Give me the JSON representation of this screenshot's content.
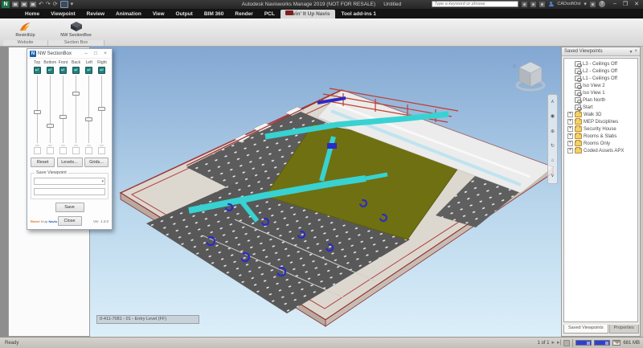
{
  "window": {
    "title": "Autodesk Navisworks Manage 2019 (NOT FOR RESALE)",
    "document": "Untitled",
    "search_placeholder": "Type a keyword or phrase",
    "signin": "CADsoftOst",
    "minimize": "–",
    "maximize": "❐",
    "close": "✕"
  },
  "ribbon": {
    "tabs": [
      {
        "label": "Home"
      },
      {
        "label": "Viewpoint"
      },
      {
        "label": "Review"
      },
      {
        "label": "Animation"
      },
      {
        "label": "View"
      },
      {
        "label": "Output"
      },
      {
        "label": "BIM 360"
      },
      {
        "label": "Render"
      },
      {
        "label": "PCL"
      },
      {
        "label": "Revin' It Up Navis",
        "active": true
      },
      {
        "label": "Tool add-ins 1"
      }
    ],
    "groups": [
      {
        "label": "Website",
        "button": "RevinItUp"
      },
      {
        "label": "Section Box",
        "button": "NW SectionBox"
      }
    ]
  },
  "dialog": {
    "title": "NW SectionBox",
    "sliders": [
      {
        "label": "Top",
        "value": 53
      },
      {
        "label": "Bottom",
        "value": 74
      },
      {
        "label": "Front",
        "value": 61
      },
      {
        "label": "Back",
        "value": 26
      },
      {
        "label": "Left",
        "value": 64
      },
      {
        "label": "Right",
        "value": 49
      }
    ],
    "buttons": {
      "reset": "Reset",
      "levels": "Levels...",
      "grids": "Grids...",
      "save": "Save",
      "close": "Close"
    },
    "save_viewpoint_label": "Save Viewpoint",
    "combo_value": "",
    "input_value": "",
    "brand": {
      "p1": "Revin'",
      "p2": " It Up ",
      "p3": "Navis"
    },
    "version": "Ver. 1.0.0"
  },
  "saved_viewpoints": {
    "title": "Saved Viewpoints",
    "items": [
      {
        "label": "L3 - Ceilings Off",
        "type": "view"
      },
      {
        "label": "L2 - Ceilings Off",
        "type": "view"
      },
      {
        "label": "L1 - Ceilings Off",
        "type": "view"
      },
      {
        "label": "Iso View 2",
        "type": "view"
      },
      {
        "label": "Iso View 1",
        "type": "view"
      },
      {
        "label": "Plan North",
        "type": "view"
      },
      {
        "label": "Start",
        "type": "view"
      },
      {
        "label": "Walk 3D",
        "type": "folder"
      },
      {
        "label": "MEP Disciplines",
        "type": "folder"
      },
      {
        "label": "Security House",
        "type": "folder"
      },
      {
        "label": "Rooms & Slabs",
        "type": "folder"
      },
      {
        "label": "Rooms Only",
        "type": "folder"
      },
      {
        "label": "Coded Assets APX",
        "type": "folder"
      }
    ],
    "tabs": [
      {
        "label": "Saved Viewpoints",
        "active": true
      },
      {
        "label": "Properties",
        "active": false
      }
    ]
  },
  "viewport": {
    "tooltip": "0-411-7081 - 01 - Entry Level (FF)",
    "nav_icons": [
      "∧",
      "◉",
      "⊕",
      "↻",
      "⌂",
      "∨"
    ]
  },
  "statusbar": {
    "ready": "Ready",
    "sheet_nav": "1 of 1",
    "memory": "681 MB"
  },
  "colors": {
    "accent_teal": "#20807d",
    "duct_cyan": "#38d2d2",
    "duct_blue": "#2b2bc4",
    "wall_red": "#a03030",
    "courtyard_olive": "#6f7012",
    "brand_orange": "#e06a10"
  }
}
